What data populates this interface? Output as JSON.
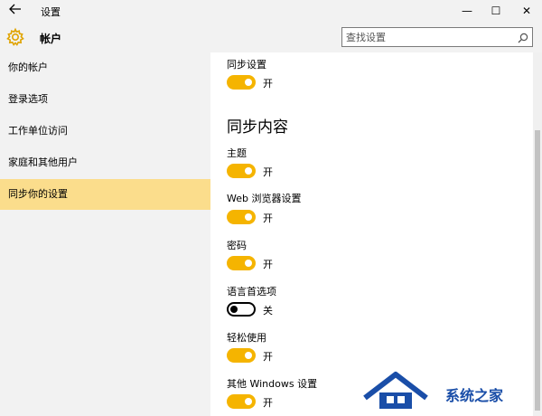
{
  "window": {
    "title": "设置",
    "back_icon": "back-arrow-icon",
    "minimize_glyph": "—",
    "maximize_glyph": "☐",
    "close_glyph": "✕"
  },
  "header": {
    "icon": "gear-icon",
    "title": "帐户"
  },
  "search": {
    "placeholder": "查找设置"
  },
  "sidebar": {
    "items": [
      {
        "label": "你的帐户",
        "selected": false
      },
      {
        "label": "登录选项",
        "selected": false
      },
      {
        "label": "工作单位访问",
        "selected": false
      },
      {
        "label": "家庭和其他用户",
        "selected": false
      },
      {
        "label": "同步你的设置",
        "selected": true
      }
    ]
  },
  "main": {
    "sync_settings": {
      "label": "同步设置",
      "state": "开",
      "on": true
    },
    "group_heading": "同步内容",
    "items": [
      {
        "label": "主题",
        "state": "开",
        "on": true
      },
      {
        "label": "Web 浏览器设置",
        "state": "开",
        "on": true
      },
      {
        "label": "密码",
        "state": "开",
        "on": true
      },
      {
        "label": "语言首选项",
        "state": "关",
        "on": false
      },
      {
        "label": "轻松使用",
        "state": "开",
        "on": true
      },
      {
        "label": "其他 Windows 设置",
        "state": "开",
        "on": true
      }
    ]
  },
  "watermark": {
    "text": "系统之家"
  },
  "colors": {
    "accent": "#f5b400",
    "selected_nav": "#fbdd8c",
    "chrome": "#f2f2f2"
  }
}
